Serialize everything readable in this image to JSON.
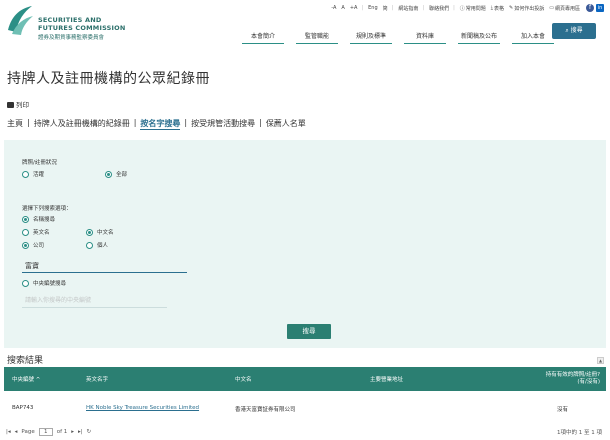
{
  "header": {
    "logo_en_line1": "SECURITIES AND",
    "logo_en_line2": "FUTURES COMMISSION",
    "logo_zh": "證券及期貨事務監察委員會",
    "util": {
      "font_small": "-A",
      "font_medium": "A",
      "font_large": "+A",
      "lang_en": "Eng",
      "lang_sc": "简",
      "sitemap": "網站指南",
      "contact": "聯絡我們",
      "faq": "常用問題",
      "forms": "表格",
      "complaint": "如何作出投訴",
      "report": "網頁專用區"
    },
    "nav": [
      "本會簡介",
      "監管職能",
      "規則及標準",
      "資料庫",
      "新聞稿及公布",
      "加入本會"
    ],
    "search_label": "搜尋"
  },
  "page": {
    "title": "持牌人及註冊機構的公眾紀錄冊",
    "print": "列印",
    "subnav": [
      "主頁",
      "持牌人及註冊機構的紀錄冊",
      "按名字搜尋",
      "按受規管活動搜尋",
      "保薦人名單"
    ]
  },
  "search": {
    "status_label": "牌照/註冊狀況",
    "status_active": "活躍",
    "status_all": "全部",
    "choose_label": "選擇下列搜索選項：",
    "by_name": "名稱搜尋",
    "english_name": "英文名",
    "chinese_name": "中文名",
    "company": "公司",
    "individual": "個人",
    "name_value": "富寶",
    "by_ce": "中央編號搜尋",
    "ce_placeholder": "請輸入你搜尋的中央編號",
    "submit": "搜尋"
  },
  "results": {
    "title": "搜索結果",
    "columns": {
      "ce": "中央編號 ^",
      "en_name": "英文名字",
      "zh_name": "中文名",
      "address": "主要營業地址",
      "status_line1": "持有有效的牌照/註冊?",
      "status_line2": "(有/沒有)"
    },
    "rows": [
      {
        "ce": "BAP743",
        "en_name": "HK Noble Sky Treasure Securities Limited",
        "zh_name": "香港天富寶証券有限公司",
        "address": "",
        "status": "沒有"
      }
    ],
    "pager": {
      "page_label": "Page",
      "page_value": "1",
      "of_label": "of 1",
      "summary": "1項中的 1 至 1 項"
    }
  },
  "colors": {
    "brand_teal": "#2b7f72",
    "panel_bg": "#eaf5f3",
    "link_blue": "#2b6f8f"
  }
}
